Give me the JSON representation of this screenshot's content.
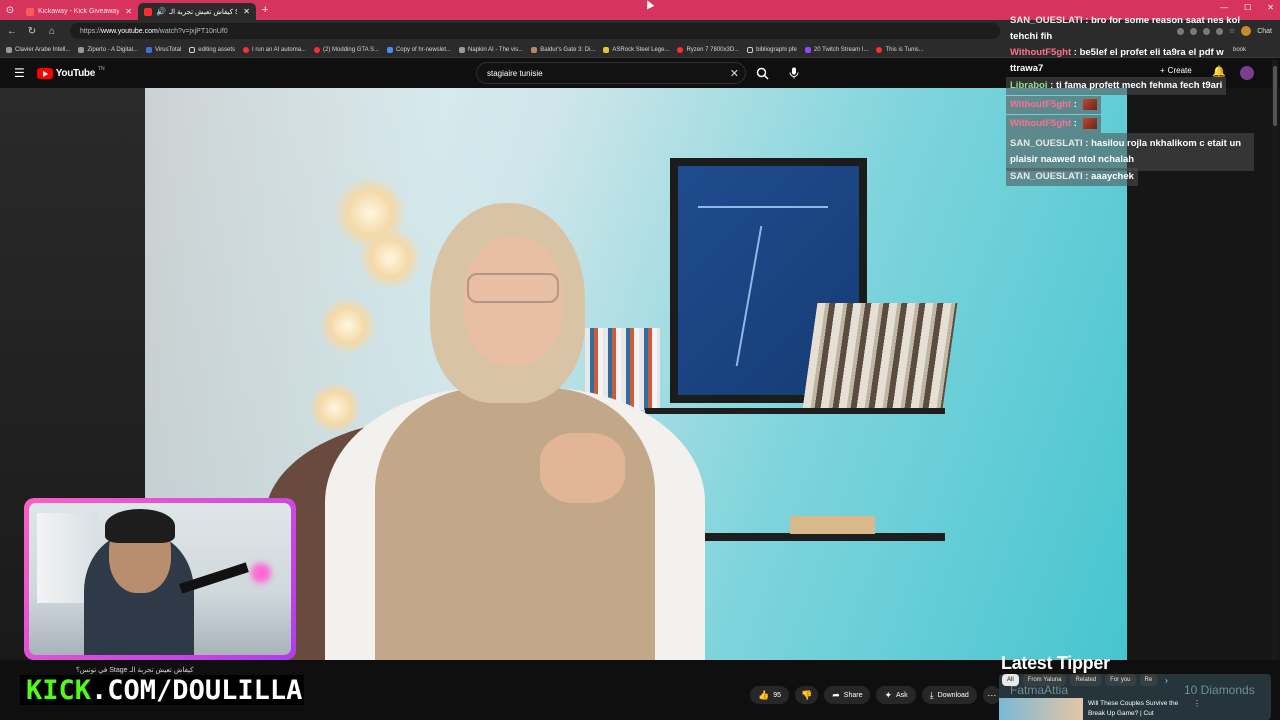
{
  "browser": {
    "tabs": [
      {
        "title": "Kickaway - Kick Giveaway Tool"
      },
      {
        "title": "كيفاش تعيش تجربة الـ Stage ف..."
      }
    ],
    "new_tab": "+",
    "url_prefix": "https://",
    "url_host": "www.youtube.com",
    "url_path": "/watch?v=jxjPT10nUf0",
    "chat_button": "Chat",
    "bookmarks": [
      "Clavier Arabe Intell...",
      "Ziperto - A Digital...",
      "VirusTotal",
      "editing assets",
      "I run an AI automa...",
      "(2) Modding GTA S...",
      "Copy of hr-newslet...",
      "Napkin AI - The vis...",
      "Baldur's Gate 3: Di...",
      "ASRock Steel Lege...",
      "Ryzen 7 7800x3D...",
      "bibliographi pfe",
      "20 Twitch Stream I...",
      "This is Tunis..."
    ],
    "bookmarks_trailing": "book"
  },
  "youtube": {
    "logo_text": "YouTube",
    "logo_tn": "TN",
    "search_value": "stagiaire tunisie",
    "create_label": "Create"
  },
  "chat": [
    {
      "user": "SAN_OUESLATI",
      "message": "bro for some reason saat nes kol tehchi fih"
    },
    {
      "user": "WithoutF5ght",
      "message": "be5lef el profet eli ta9ra el pdf w ttrawa7"
    },
    {
      "user": "Libraboi",
      "message": "ti fama profett mech fehma fech t9ari"
    },
    {
      "user": "WithoutF5ght",
      "message": ""
    },
    {
      "user": "WithoutF5ght",
      "message": ""
    },
    {
      "user": "SAN_OUESLATI",
      "message": "hasilou rojla nkhalikom c etait un plaisir naawed ntol nchalah"
    },
    {
      "user": "SAN_OUESLATI",
      "message": "aaaychek"
    }
  ],
  "chat_separator": " : ",
  "overlay": {
    "video_subtitle": "في تونس؟ Stage كيفاش تعيش تجربة الـ",
    "kick_green": "KICK",
    "kick_white": ".COM/DOULILLA",
    "latest_tipper_title": "Latest Tipper",
    "latest_tipper_name": "FatmaAttia",
    "latest_tipper_amount": "10 Diamonds"
  },
  "actions": {
    "like_count": "95",
    "share": "Share",
    "ask": "Ask",
    "download": "Download"
  },
  "related": {
    "chips": [
      "All",
      "From Yaluna",
      "Related",
      "For you",
      "Re"
    ],
    "video_title": "Will These Couples Survive the Break Up Game? | Cut"
  }
}
